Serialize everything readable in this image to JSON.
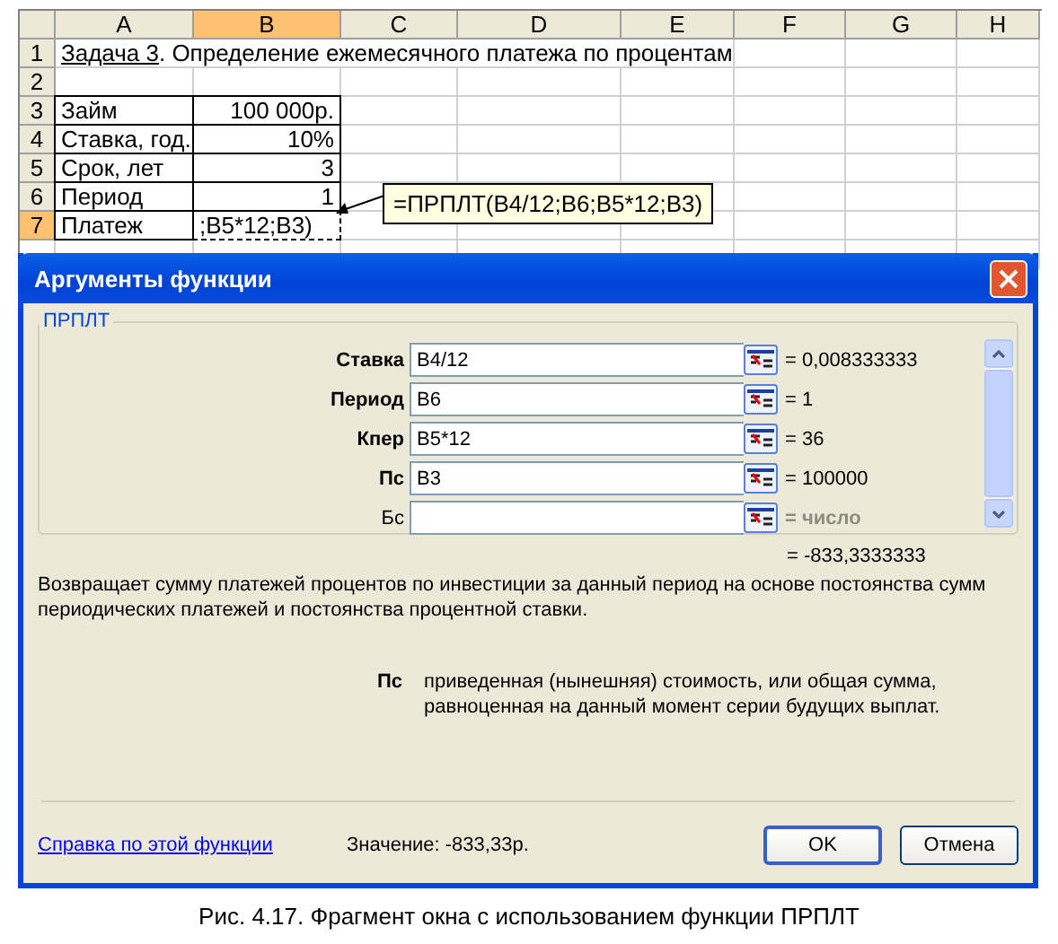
{
  "sheet": {
    "columns": [
      {
        "label": "A",
        "selected": false
      },
      {
        "label": "B",
        "selected": true
      },
      {
        "label": "C",
        "selected": false
      },
      {
        "label": "D",
        "selected": false
      },
      {
        "label": "E",
        "selected": false
      },
      {
        "label": "F",
        "selected": false
      },
      {
        "label": "G",
        "selected": false
      },
      {
        "label": "H",
        "selected": false
      }
    ],
    "rows": [
      {
        "number": "1",
        "selected": false,
        "kind": "title",
        "segments": [
          {
            "text": "Задача 3",
            "underlined": true
          },
          {
            "text": ". Определение ежемесячного платежа по процентам",
            "underlined": false
          }
        ]
      },
      {
        "number": "2",
        "selected": false,
        "kind": "blank"
      },
      {
        "number": "3",
        "selected": false,
        "kind": "data",
        "a": "Займ",
        "b": "100 000р."
      },
      {
        "number": "4",
        "selected": false,
        "kind": "data",
        "a": "Ставка, год.",
        "b": "10%"
      },
      {
        "number": "5",
        "selected": false,
        "kind": "data",
        "a": "Срок, лет",
        "b": "3"
      },
      {
        "number": "6",
        "selected": false,
        "kind": "data",
        "a": "Период",
        "b": "1"
      },
      {
        "number": "7",
        "selected": true,
        "kind": "edit",
        "a": "Платеж",
        "b": ";B5*12;B3)"
      }
    ],
    "tooltip": "=ПРПЛТ(B4/12;B6;B5*12;B3)"
  },
  "dialog": {
    "title": "Аргументы функции",
    "group": "ПРПЛТ",
    "arguments": [
      {
        "label": "Ставка",
        "value": "B4/12",
        "result": "= 0,008333333",
        "bold": true,
        "muted": false
      },
      {
        "label": "Период",
        "value": "B6",
        "result": "= 1",
        "bold": true,
        "muted": false
      },
      {
        "label": "Кпер",
        "value": "B5*12",
        "result": "= 36",
        "bold": true,
        "muted": false
      },
      {
        "label": "Пс",
        "value": "B3",
        "result": "= 100000",
        "bold": true,
        "muted": false
      },
      {
        "label": "Бс",
        "result": "= число",
        "bold": false,
        "muted": true
      }
    ],
    "total": "= -833,3333333",
    "description": "Возвращает сумму платежей процентов по инвестиции за данный период на основе постоянства сумм периодических платежей и постоянства процентной ставки.",
    "param_name": "Пс",
    "param_help": "приведенная (нынешняя) стоимость, или общая сумма, равноценная на данный момент серии будущих выплат.",
    "help_link": "Справка по этой функции",
    "value_text": "Значение: -833,33р.",
    "buttons": [
      {
        "label": "OK",
        "default": true
      },
      {
        "label": "Отмена",
        "default": false
      }
    ]
  },
  "caption": "Рис. 4.17. Фрагмент окна с использованием функции ПРПЛТ"
}
